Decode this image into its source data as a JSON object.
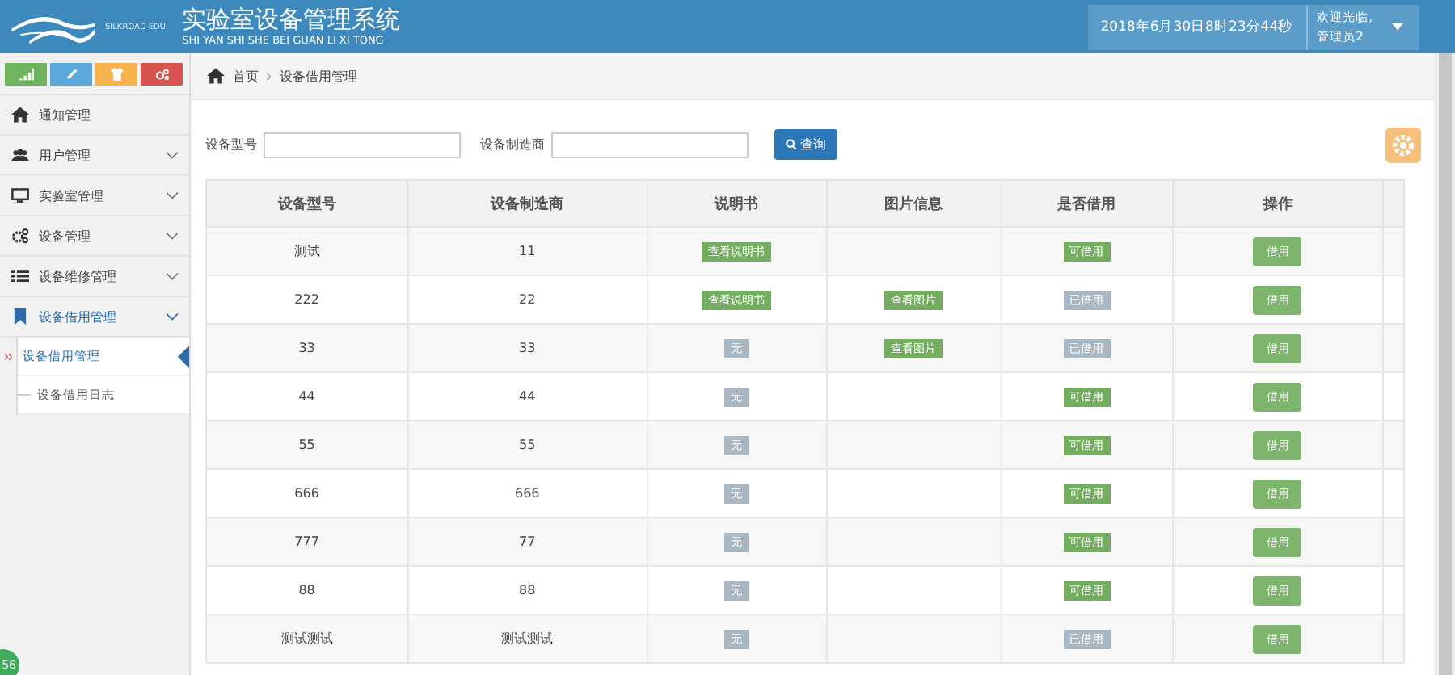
{
  "header": {
    "logo_text": "SILKROAD EDU",
    "title": "实验室设备管理系统",
    "subtitle": "SHI YAN SHI SHE BEI GUAN LI XI TONG",
    "datetime": "2018年6月30日8时23分44秒",
    "welcome": "欢迎光临,",
    "user": "管理员2"
  },
  "sidebar": {
    "items": [
      {
        "label": "通知管理"
      },
      {
        "label": "用户管理",
        "expanded": false
      },
      {
        "label": "实验室管理",
        "expanded": false
      },
      {
        "label": "设备管理",
        "expanded": false
      },
      {
        "label": "设备维修管理",
        "expanded": false
      },
      {
        "label": "设备借用管理",
        "expanded": true,
        "children": [
          {
            "label": "设备借用管理",
            "selected": true
          },
          {
            "label": "设备借用日志",
            "selected": false
          }
        ]
      }
    ]
  },
  "breadcrumb": [
    "首页",
    "设备借用管理"
  ],
  "search": {
    "fields": [
      {
        "label": "设备型号"
      },
      {
        "label": "设备制造商"
      }
    ],
    "button": "查询"
  },
  "table": {
    "columns": [
      "设备型号",
      "设备制造商",
      "说明书",
      "图片信息",
      "是否借用",
      "操作"
    ],
    "rows": [
      {
        "model": "测试",
        "maker": "11",
        "manual": "查看说明书",
        "manual_available": true,
        "picture": null,
        "status": "可借用",
        "borrowed": false,
        "action": "借用"
      },
      {
        "model": "222",
        "maker": "22",
        "manual": "查看说明书",
        "manual_available": true,
        "picture": "查看图片",
        "status": "已借用",
        "borrowed": true,
        "action": "借用"
      },
      {
        "model": "33",
        "maker": "33",
        "manual": "无",
        "manual_available": false,
        "picture": "查看图片",
        "status": "已借用",
        "borrowed": true,
        "action": "借用"
      },
      {
        "model": "44",
        "maker": "44",
        "manual": "无",
        "manual_available": false,
        "picture": null,
        "status": "可借用",
        "borrowed": false,
        "action": "借用"
      },
      {
        "model": "55",
        "maker": "55",
        "manual": "无",
        "manual_available": false,
        "picture": null,
        "status": "可借用",
        "borrowed": false,
        "action": "借用"
      },
      {
        "model": "666",
        "maker": "666",
        "manual": "无",
        "manual_available": false,
        "picture": null,
        "status": "可借用",
        "borrowed": false,
        "action": "借用"
      },
      {
        "model": "777",
        "maker": "77",
        "manual": "无",
        "manual_available": false,
        "picture": null,
        "status": "可借用",
        "borrowed": false,
        "action": "借用"
      },
      {
        "model": "88",
        "maker": "88",
        "manual": "无",
        "manual_available": false,
        "picture": null,
        "status": "可借用",
        "borrowed": false,
        "action": "借用"
      },
      {
        "model": "测试测试",
        "maker": "测试测试",
        "manual": "无",
        "manual_available": false,
        "picture": null,
        "status": "已借用",
        "borrowed": true,
        "action": "借用"
      }
    ]
  },
  "badge": "56"
}
